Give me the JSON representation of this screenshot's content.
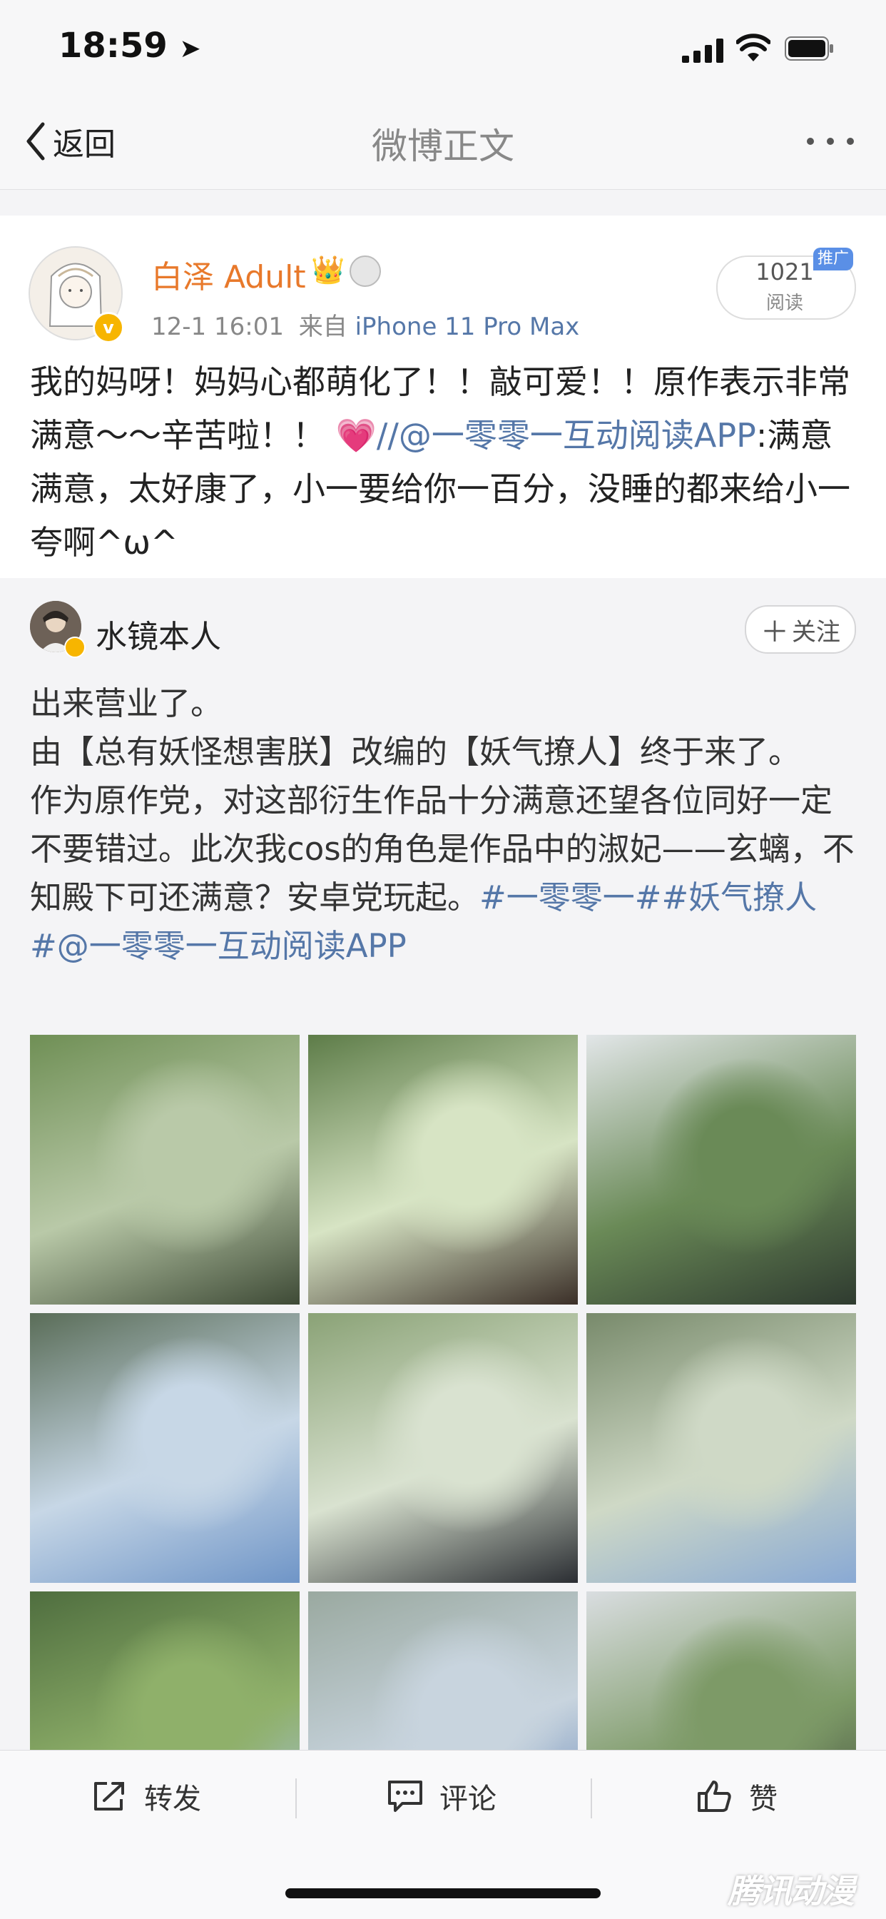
{
  "status_bar": {
    "time": "18:59"
  },
  "nav": {
    "back_label": "返回",
    "title": "微博正文"
  },
  "repost": {
    "author": "白泽 Adult",
    "time": "12-1 16:01",
    "source_prefix": "来自",
    "device": "iPhone 11 Pro Max",
    "read_count": "1021",
    "read_label": "阅读",
    "promo_badge": "推广",
    "text_main": "我的妈呀！妈妈心都萌化了！！敲可爱！！原作表示非常满意～～辛苦啦！！",
    "emoji": "💗",
    "slashes": "//",
    "mention": "@一零零一互动阅读APP",
    "quote": ":满意满意，太好康了，小一要给你一百分，没睡的都来给小一夸啊^ω^"
  },
  "original": {
    "author": "水镜本人",
    "follow_label": "关注",
    "line1": "出来营业了。",
    "line2": "由【总有妖怪想害朕】改编的【妖气撩人】终于来了。",
    "line3": "作为原作党，对这部衍生作品十分满意还望各位同好一定不要错过。此次我cos的角色是作品中的淑妃——玄螭，不知殿下可还满意？安卓党玩起。",
    "tag1": "#一零零一#",
    "tag2": "#妖气撩人#",
    "mention": "@一零零一互动阅读APP"
  },
  "photos": [
    {
      "name": "photo-1",
      "colors": [
        "#6f8f55",
        "#b9c9a8",
        "#3e4a36"
      ]
    },
    {
      "name": "photo-2",
      "colors": [
        "#5d7c48",
        "#d7e4c4",
        "#3b2f28"
      ]
    },
    {
      "name": "photo-3",
      "colors": [
        "#e2e6e8",
        "#6a8a57",
        "#2f3b30"
      ]
    },
    {
      "name": "photo-4",
      "colors": [
        "#5a6d58",
        "#c7d7e6",
        "#6f95c7"
      ]
    },
    {
      "name": "photo-5",
      "colors": [
        "#8aa276",
        "#d9e2d0",
        "#2b2e33"
      ]
    },
    {
      "name": "photo-6",
      "colors": [
        "#788a6b",
        "#cfd9c6",
        "#89a9d4"
      ]
    },
    {
      "name": "photo-7",
      "colors": [
        "#4f6e3f",
        "#8fb06a",
        "#a9c3e4"
      ]
    },
    {
      "name": "photo-8",
      "colors": [
        "#9aa9a0",
        "#c8d4de",
        "#5b7fb3"
      ]
    },
    {
      "name": "photo-9",
      "colors": [
        "#d9dde0",
        "#7d9a67",
        "#3b4438"
      ]
    }
  ],
  "toolbar": {
    "repost_label": "转发",
    "comment_label": "评论",
    "like_label": "赞"
  },
  "watermark": "腾讯动漫",
  "colors": {
    "link": "#5577a8",
    "author_orange": "#e8792b",
    "verified": "#f7b500"
  }
}
